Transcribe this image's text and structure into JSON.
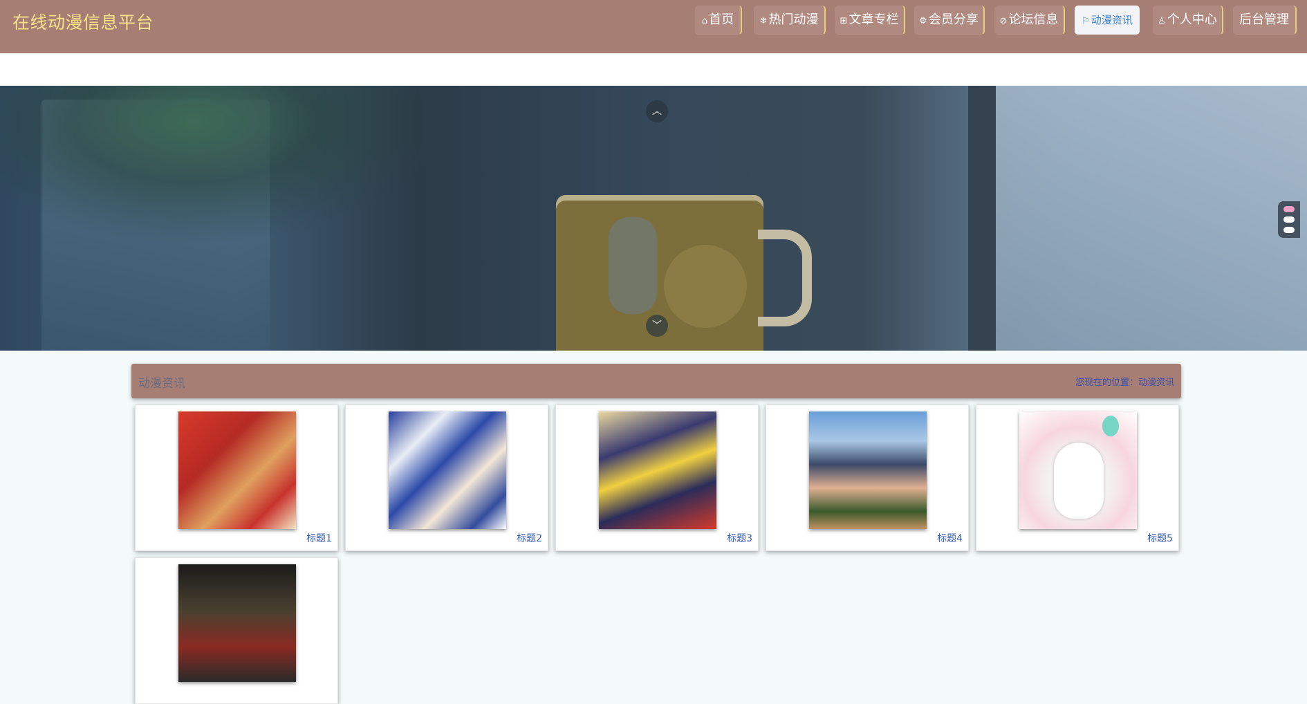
{
  "header": {
    "site_title": "在线动漫信息平台",
    "nav": [
      {
        "icon": "home-icon",
        "glyph": "⌂",
        "label": "首页"
      },
      {
        "icon": "snowflake-icon",
        "glyph": "❄",
        "label": "热门动漫"
      },
      {
        "icon": "gift-icon",
        "glyph": "⊞",
        "label": "文章专栏"
      },
      {
        "icon": "cog-icon",
        "glyph": "⚙",
        "label": "会员分享"
      },
      {
        "icon": "tag-icon",
        "glyph": "⊘",
        "label": "论坛信息"
      },
      {
        "icon": "flag-icon",
        "glyph": "⚐",
        "label": "动漫资讯",
        "active": true
      },
      {
        "icon": "user-icon",
        "glyph": "♙",
        "label": "个人中心"
      },
      {
        "icon": "",
        "glyph": "",
        "label": "后台管理"
      }
    ]
  },
  "banner": {
    "scroll_up_glyph": "︿",
    "scroll_down_glyph": "﹀",
    "slides": 3,
    "active_slide": 1
  },
  "section": {
    "title": "动漫资讯",
    "breadcrumb": "您现在的位置：动漫资讯"
  },
  "cards": [
    {
      "title": "标题1"
    },
    {
      "title": "标题2"
    },
    {
      "title": "标题3"
    },
    {
      "title": "标题4"
    },
    {
      "title": "标题5"
    },
    {
      "title": ""
    }
  ],
  "colors": {
    "header_bg": "#a67e74",
    "title_color": "#f6e08a",
    "active_nav_text": "#3b82d6",
    "page_bg": "#f4fafa",
    "link_blue": "#3a5fb6"
  }
}
